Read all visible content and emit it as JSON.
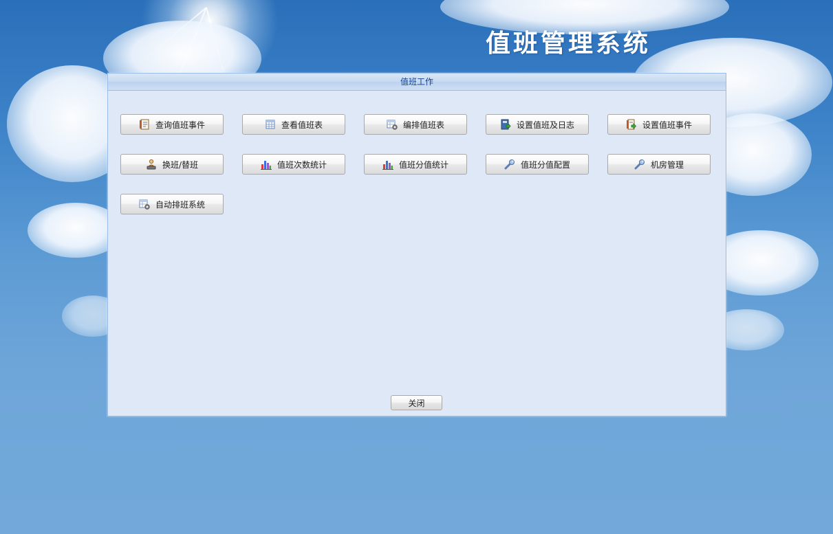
{
  "app": {
    "title": "值班管理系统"
  },
  "panel": {
    "title": "值班工作",
    "buttons": [
      {
        "label": "查询值班事件",
        "icon": "report-icon"
      },
      {
        "label": "查看值班表",
        "icon": "table-icon"
      },
      {
        "label": "编排值班表",
        "icon": "table-gear-icon"
      },
      {
        "label": "设置值班及日志",
        "icon": "book-arrow-icon"
      },
      {
        "label": "设置值班事件",
        "icon": "report-arrow-icon"
      },
      {
        "label": "换班/替班",
        "icon": "user-swap-icon"
      },
      {
        "label": "值班次数统计",
        "icon": "bar-chart-icon"
      },
      {
        "label": "值班分值统计",
        "icon": "bar-chart-icon"
      },
      {
        "label": "值班分值配置",
        "icon": "wrench-icon"
      },
      {
        "label": "机房管理",
        "icon": "wrench-icon"
      },
      {
        "label": "自动排班系统",
        "icon": "table-gear-icon"
      }
    ],
    "close_label": "关闭"
  },
  "colors": {
    "panel_bg": "#dfe8f6",
    "panel_border": "#99bbe8",
    "panel_title_text": "#15428b",
    "sky_top": "#2a6fb9",
    "sky_bottom": "#72a9da"
  }
}
